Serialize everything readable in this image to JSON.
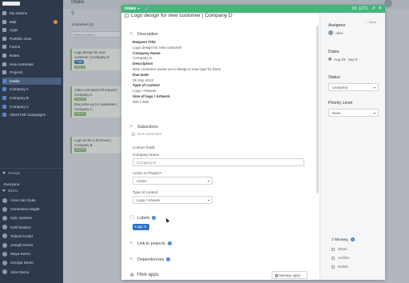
{
  "sidebar": {
    "items": [
      {
        "label": "My actions",
        "icon": "check-icon"
      },
      {
        "label": "Mail",
        "icon": "mail-icon",
        "badge": true
      },
      {
        "label": "Apps",
        "icon": "apps-icon"
      },
      {
        "label": "Portfolio view",
        "icon": "portfolio-icon"
      },
      {
        "label": "Forms",
        "icon": "form-icon"
      },
      {
        "label": "Notes",
        "icon": "note-icon"
      },
      {
        "label": "Hive Automate",
        "icon": "automate-icon"
      },
      {
        "label": "Projects",
        "icon": "folder-icon"
      },
      {
        "label": "Intake",
        "icon": "project-icon",
        "active": true
      },
      {
        "label": "Company A",
        "icon": "project-icon"
      },
      {
        "label": "Company B",
        "icon": "project-icon"
      },
      {
        "label": "Company C",
        "icon": "project-icon"
      },
      {
        "label": "Client Full Campaigns",
        "icon": "project-icon"
      }
    ],
    "groups_label": "Groups",
    "everyone_label": "Everyone",
    "direct_label": "Direct",
    "people": [
      "Anna Van Dyke",
      "Genevieve Haight",
      "Kyle Jackson",
      "Kelli Newton",
      "Toland Arnold",
      "Joseph Demo",
      "Maya Demo",
      "George Demo",
      "Alice Demo"
    ]
  },
  "background": {
    "title": "Intake",
    "column_title": "Unstarted (4)",
    "search_placeholder": "Search actions",
    "cards": [
      {
        "title": "Logo design for new customer | Company D",
        "tag": "Logo",
        "date": "Sep 9"
      },
      {
        "title": "Video Animated tell request | Company C",
        "tag": "",
        "date": "Oct 20"
      },
      {
        "title": "Blog write up for newsletter | Company C",
        "tag": "",
        "date": "Oct 21"
      },
      {
        "title": "Logo art for a brochure | Company B",
        "tag": "",
        "date": "Oct 24"
      }
    ]
  },
  "modal": {
    "status": "Intake",
    "id": "ID: 1273",
    "title": "Logo design for new customer | Company D",
    "description_label": "Description",
    "description": [
      {
        "k": "Request Title",
        "v": "Logo design for new customer"
      },
      {
        "k": "Company Name",
        "v": "Company D"
      },
      {
        "k": "Description",
        "v": "New customer wants us to design a new logo for them"
      },
      {
        "k": "Due Date",
        "v": "09 Sep 2022"
      },
      {
        "k": "Type of content",
        "v": "Logo / Artwork"
      },
      {
        "k": "Size of logo / Artwork",
        "v": "500 x 500"
      }
    ],
    "subactions_label": "Subactions",
    "new_subaction": "New subaction",
    "custom_fields_label": "Custom fields",
    "company_name_label": "Company Name",
    "company_name_value": "Company D",
    "action_label": "Action or Project?",
    "action_value": "Action",
    "content_type_label": "Type of content",
    "content_type_value": "Logo / Artwork",
    "labels_label": "Labels",
    "label_chip": "Logo",
    "link_label": "Link to projects",
    "dependencies_label": "Dependencies",
    "hive_apps_label": "Hive apps",
    "manage_apps": "Manage apps"
  },
  "right": {
    "more": "More",
    "assignee_label": "Assignee",
    "assignee": "Alice",
    "dates_label": "Dates",
    "dates": "Aug 29 - Sep 9",
    "status_label": "Status",
    "status_value": "Unstarted",
    "priority_label": "Priority Level",
    "priority_value": "None",
    "following": "2 following",
    "share": "Share",
    "archive": "Archive",
    "delete": "Delete"
  },
  "colors": {
    "header_green": "#45b57c",
    "sidebar": "#2e3a4c",
    "label_blue": "#2f73c7"
  }
}
